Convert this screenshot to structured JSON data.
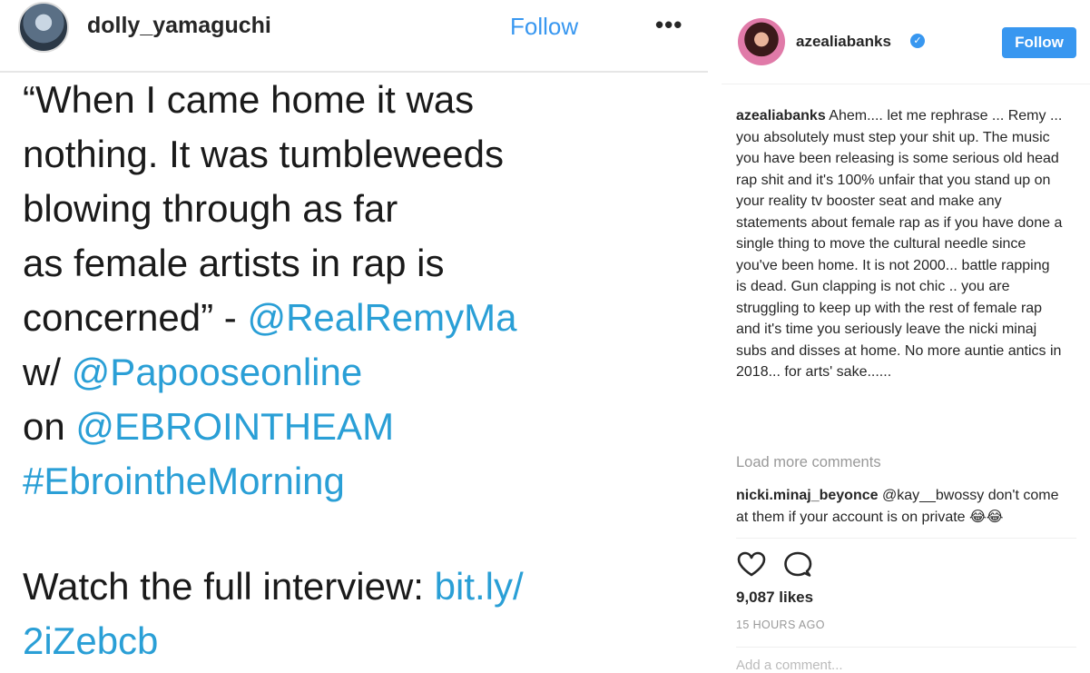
{
  "left_post": {
    "username": "dolly_yamaguchi",
    "follow_label": "Follow",
    "more_label": "•••",
    "quote_lines": [
      [
        {
          "t": "“When I came home it was",
          "link": false
        }
      ],
      [
        {
          "t": "nothing. It was tumbleweeds",
          "link": false
        }
      ],
      [
        {
          "t": "blowing through as far",
          "link": false
        }
      ],
      [
        {
          "t": "as female artists in rap is",
          "link": false
        }
      ],
      [
        {
          "t": "concerned” - ",
          "link": false
        },
        {
          "t": "@RealRemyMa",
          "link": true
        }
      ],
      [
        {
          "t": "w/ ",
          "link": false
        },
        {
          "t": "@Papooseonline",
          "link": true
        }
      ],
      [
        {
          "t": "on ",
          "link": false
        },
        {
          "t": "@EBROINTHEAM",
          "link": true
        }
      ],
      [
        {
          "t": "#EbrointheMorning",
          "link": true
        }
      ]
    ],
    "watch_lines": [
      [
        {
          "t": "Watch the full interview: ",
          "link": false
        },
        {
          "t": "bit.ly/",
          "link": true
        }
      ],
      [
        {
          "t": "2iZebcb",
          "link": true
        }
      ]
    ]
  },
  "right_post": {
    "username": "azealiabanks",
    "verified_glyph": "✓",
    "follow_label": "Follow",
    "caption_author": "azealiabanks",
    "caption_text": "Ahem.... let me rephrase ... Remy ... you absolutely must step your shit up. The music you have been releasing is some serious old head rap shit and it's 100% unfair that you stand up on your reality tv booster seat and make any statements about female rap as if you have done a single thing to move the cultural needle since you've been home. It is not 2000... battle rapping is dead. Gun clapping is not chic .. you are struggling to keep up with the rest of female rap and it's time you seriously leave the nicki minaj subs and disses at home. No more auntie antics in 2018... for arts' sake......",
    "load_more_label": "Load more comments",
    "comment2_author": "nicki.minaj_beyonce",
    "comment2_text": "@kay__bwossy don't come at them if your account is on private 😂😂",
    "likes": "9,087 likes",
    "time": "15 HOURS AGO",
    "add_comment_placeholder": "Add a comment..."
  },
  "colors": {
    "link_blue": "#2a9fd6",
    "ig_blue": "#3897f0",
    "text": "#262626",
    "muted": "#999999"
  },
  "icons": [
    "heart-icon",
    "comment-icon",
    "verified-badge-icon",
    "more-options-icon"
  ]
}
